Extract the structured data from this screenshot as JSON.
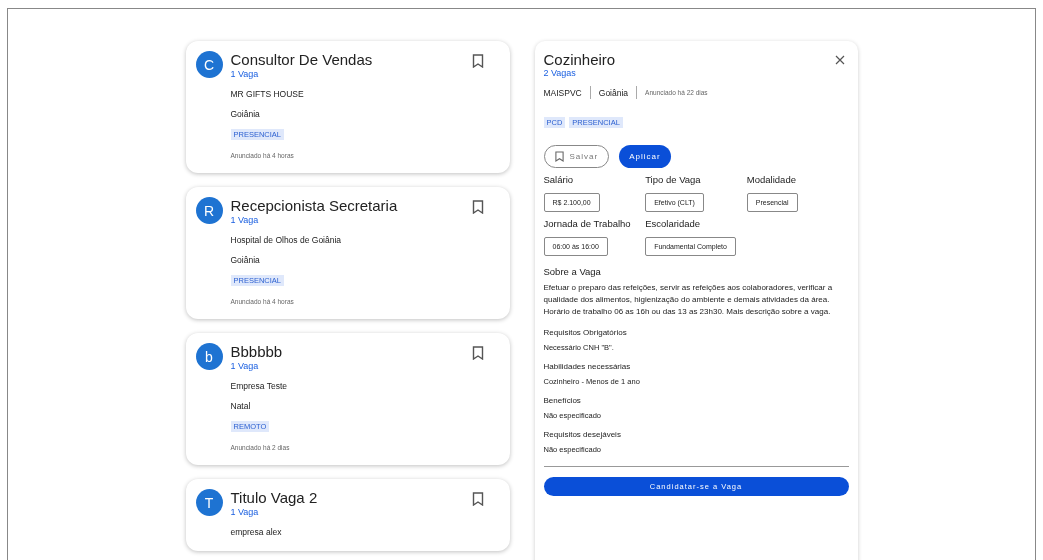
{
  "jobs": [
    {
      "initial": "C",
      "title": "Consultor De Vendas",
      "vacancies": "1 Vaga",
      "company": "MR GIFTS HOUSE",
      "city": "Goiânia",
      "tag": "PRESENCIAL",
      "posted": "Anunciado há 4 horas"
    },
    {
      "initial": "R",
      "title": "Recepcionista Secretaria",
      "vacancies": "1 Vaga",
      "company": "Hospital de Olhos de Goiânia",
      "city": "Goiânia",
      "tag": "PRESENCIAL",
      "posted": "Anunciado há 4 horas"
    },
    {
      "initial": "b",
      "title": "Bbbbbb",
      "vacancies": "1 Vaga",
      "company": "Empresa Teste",
      "city": "Natal",
      "tag": "REMOTO",
      "posted": "Anunciado há 2 dias"
    },
    {
      "initial": "T",
      "title": "Titulo Vaga 2",
      "vacancies": "1 Vaga",
      "company": "empresa alex"
    }
  ],
  "detail": {
    "title": "Cozinheiro",
    "vacancies": "2 Vagas",
    "company": "MAISPVC",
    "city": "Goiânia",
    "posted": "Anunciado há 22 dias",
    "tags": [
      "PCD",
      "PRESENCIAL"
    ],
    "save_button": "Salvar",
    "apply_button": "Aplicar",
    "fields": [
      {
        "label": "Salário",
        "value": "R$ 2.100,00"
      },
      {
        "label": "Tipo de Vaga",
        "value": "Efetivo (CLT)"
      },
      {
        "label": "Modalidade",
        "value": "Presencial"
      },
      {
        "label": "Jornada de Trabalho",
        "value": "06:00 às 16:00"
      },
      {
        "label": "Escolaridade",
        "value": "Fundamental Completo"
      }
    ],
    "about_title": "Sobre a Vaga",
    "about_text": "Efetuar o preparo das refeições, servir as refeições aos colaboradores, verificar a qualidade dos alimentos, higienização do ambiente e demais atividades da área. Horário de trabalho 06 as 16h ou das 13 as 23h30. Mais descrição sobre a vaga.",
    "sections": [
      {
        "title": "Requisitos Obrigatórios",
        "text": "Necessário CNH \"B\"."
      },
      {
        "title": "Habilidades necessárias",
        "text": "Cozinheiro - Menos de 1 ano"
      },
      {
        "title": "Benefícios",
        "text": "Não especificado"
      },
      {
        "title": "Requisitos desejáveis",
        "text": "Não especificado"
      }
    ],
    "submit_button": "Candidatar-se a Vaga"
  }
}
